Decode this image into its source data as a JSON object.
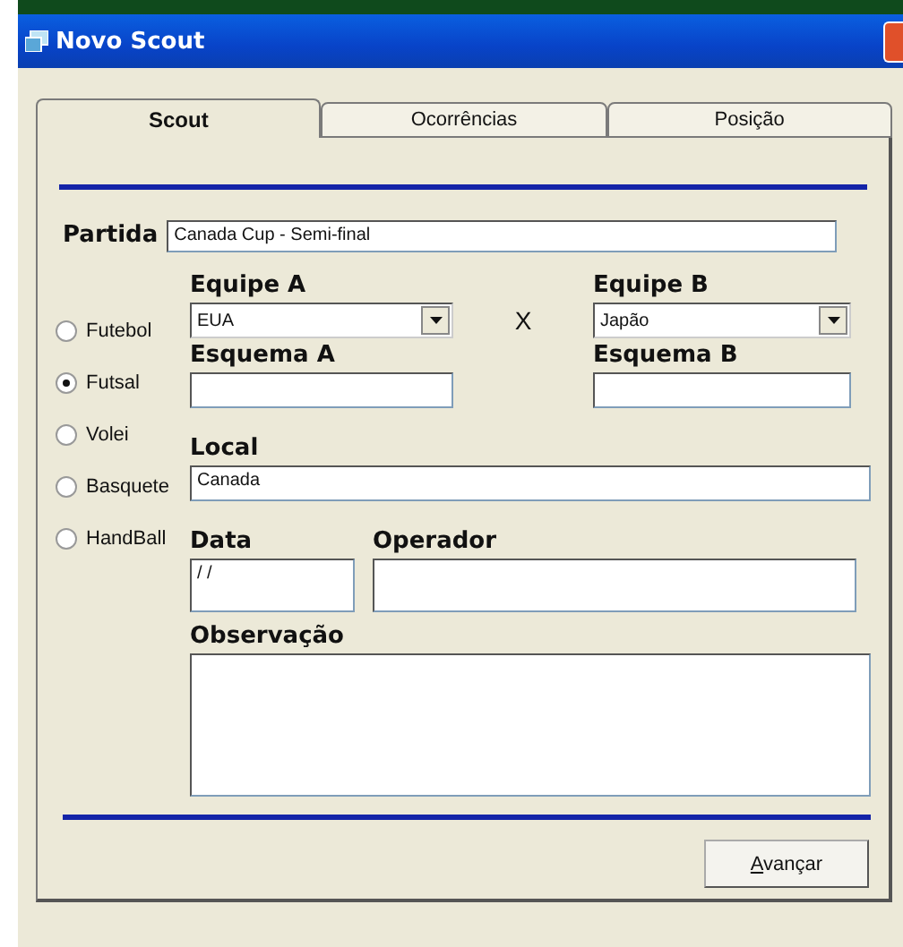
{
  "window": {
    "title": "Novo Scout"
  },
  "tabs": [
    {
      "label": "Scout",
      "selected": true
    },
    {
      "label": "Ocorrências",
      "selected": false
    },
    {
      "label": "Posição",
      "selected": false
    }
  ],
  "partida": {
    "label": "Partida",
    "value": "Canada Cup - Semi-final"
  },
  "sports": [
    {
      "label": "Futebol",
      "selected": false
    },
    {
      "label": "Futsal",
      "selected": true
    },
    {
      "label": "Volei",
      "selected": false
    },
    {
      "label": "Basquete",
      "selected": false
    },
    {
      "label": "HandBall",
      "selected": false
    }
  ],
  "equipe_a": {
    "label": "Equipe A",
    "value": "EUA"
  },
  "versus": "X",
  "equipe_b": {
    "label": "Equipe B",
    "value": "Japão"
  },
  "esquema_a": {
    "label": "Esquema A"
  },
  "esquema_b": {
    "label": "Esquema B"
  },
  "local": {
    "label": "Local",
    "value": "Canada"
  },
  "data": {
    "label": "Data",
    "value": "/ /"
  },
  "operador": {
    "label": "Operador"
  },
  "observacao": {
    "label": "Observação"
  },
  "button": "Avançar"
}
